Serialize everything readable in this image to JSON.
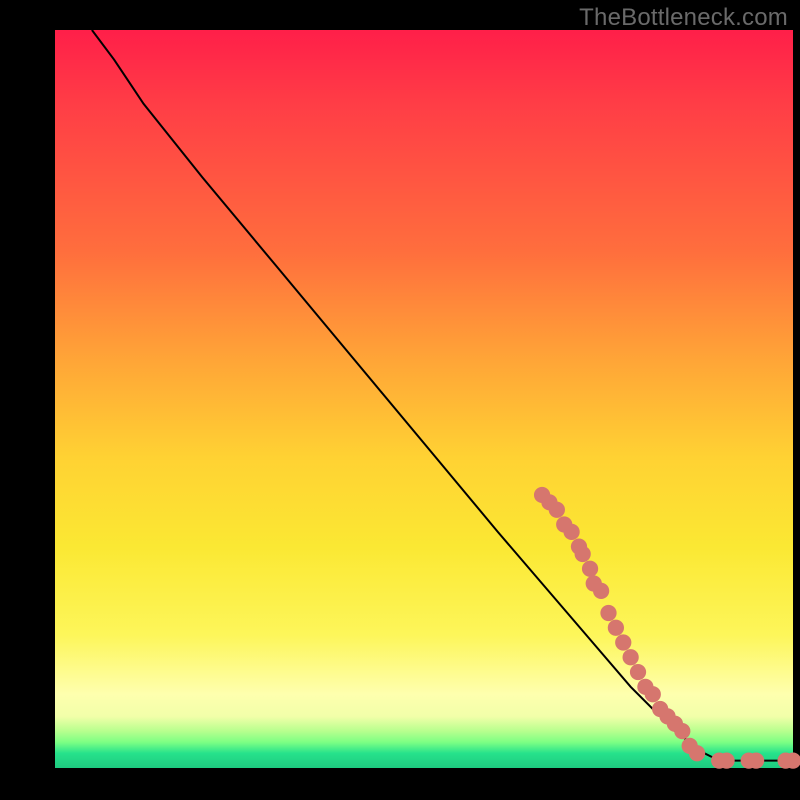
{
  "attribution": "TheBottleneck.com",
  "colors": {
    "dot": "#d6766e",
    "curve": "#000000",
    "background_frame": "#000000"
  },
  "chart_data": {
    "type": "line",
    "title": "",
    "xlabel": "",
    "ylabel": "",
    "xlim": [
      0,
      100
    ],
    "ylim": [
      0,
      100
    ],
    "curve_points": [
      {
        "x": 5,
        "y": 100
      },
      {
        "x": 8,
        "y": 96
      },
      {
        "x": 12,
        "y": 90
      },
      {
        "x": 20,
        "y": 80
      },
      {
        "x": 30,
        "y": 68
      },
      {
        "x": 40,
        "y": 56
      },
      {
        "x": 50,
        "y": 44
      },
      {
        "x": 60,
        "y": 32
      },
      {
        "x": 66,
        "y": 25
      },
      {
        "x": 72,
        "y": 18
      },
      {
        "x": 78,
        "y": 11
      },
      {
        "x": 84,
        "y": 5
      },
      {
        "x": 88,
        "y": 2
      },
      {
        "x": 90,
        "y": 1
      },
      {
        "x": 92,
        "y": 1
      },
      {
        "x": 95,
        "y": 1
      },
      {
        "x": 98,
        "y": 1
      },
      {
        "x": 100,
        "y": 1
      }
    ],
    "marker_points": [
      {
        "x": 66,
        "y": 37
      },
      {
        "x": 67,
        "y": 36
      },
      {
        "x": 68,
        "y": 35
      },
      {
        "x": 69,
        "y": 33
      },
      {
        "x": 70,
        "y": 32
      },
      {
        "x": 71,
        "y": 30
      },
      {
        "x": 71.5,
        "y": 29
      },
      {
        "x": 72.5,
        "y": 27
      },
      {
        "x": 73,
        "y": 25
      },
      {
        "x": 74,
        "y": 24
      },
      {
        "x": 75,
        "y": 21
      },
      {
        "x": 76,
        "y": 19
      },
      {
        "x": 77,
        "y": 17
      },
      {
        "x": 78,
        "y": 15
      },
      {
        "x": 79,
        "y": 13
      },
      {
        "x": 80,
        "y": 11
      },
      {
        "x": 81,
        "y": 10
      },
      {
        "x": 82,
        "y": 8
      },
      {
        "x": 83,
        "y": 7
      },
      {
        "x": 84,
        "y": 6
      },
      {
        "x": 85,
        "y": 5
      },
      {
        "x": 86,
        "y": 3
      },
      {
        "x": 87,
        "y": 2
      },
      {
        "x": 90,
        "y": 1
      },
      {
        "x": 91,
        "y": 1
      },
      {
        "x": 94,
        "y": 1
      },
      {
        "x": 95,
        "y": 1
      },
      {
        "x": 99,
        "y": 1
      },
      {
        "x": 100,
        "y": 1
      }
    ]
  }
}
